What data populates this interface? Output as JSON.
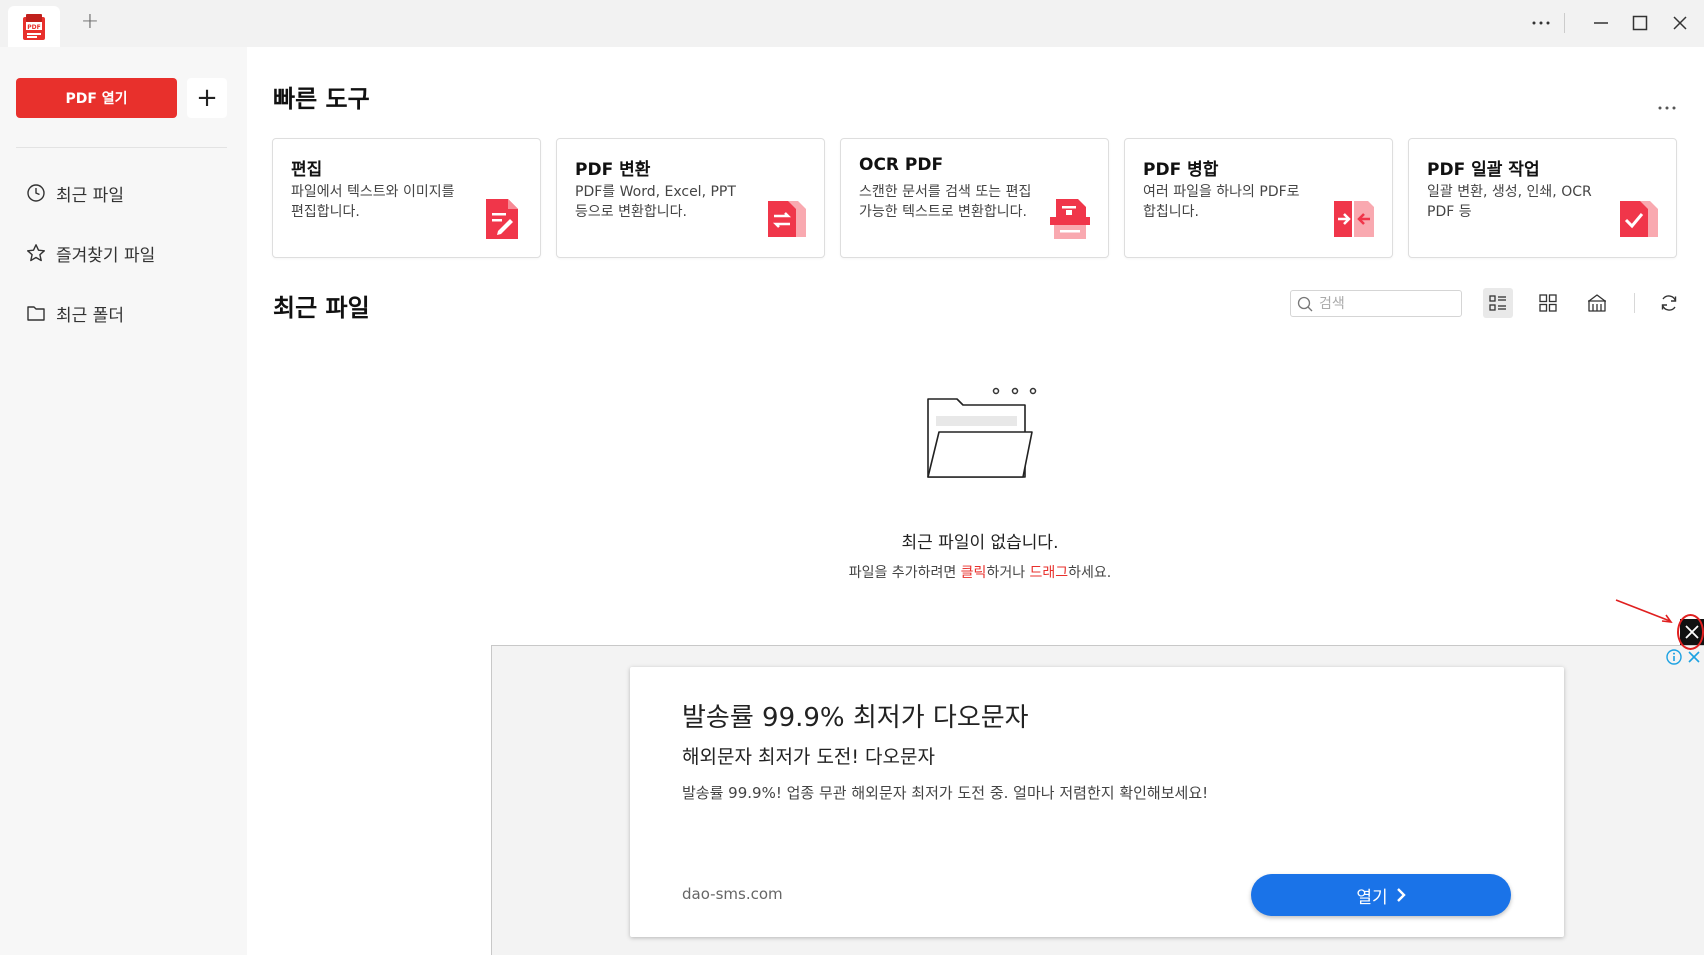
{
  "titlebar": {
    "app_icon": "pdf-app-logo",
    "new_tab_label": "+",
    "more_label": "···"
  },
  "sidebar": {
    "open_pdf_label": "PDF 열기",
    "add_label": "+",
    "items": [
      {
        "label": "최근 파일",
        "icon": "clock-icon"
      },
      {
        "label": "즐겨찾기 파일",
        "icon": "star-icon"
      },
      {
        "label": "최근 폴더",
        "icon": "folder-icon"
      }
    ]
  },
  "quick_tools": {
    "title": "빠른 도구",
    "more_label": "···",
    "cards": [
      {
        "title": "편집",
        "desc": "파일에서 텍스트와 이미지를 편집합니다.",
        "icon": "edit-pdf-icon"
      },
      {
        "title": "PDF 변환",
        "desc": "PDF를 Word, Excel, PPT 등으로 변환합니다.",
        "icon": "convert-pdf-icon"
      },
      {
        "title": "OCR PDF",
        "desc": "스캔한 문서를 검색 또는 편집 가능한 텍스트로 변환합니다.",
        "icon": "ocr-pdf-icon"
      },
      {
        "title": "PDF 병합",
        "desc": "여러 파일을 하나의 PDF로 합칩니다.",
        "icon": "merge-pdf-icon"
      },
      {
        "title": "PDF 일괄 작업",
        "desc": "일괄 변환, 생성, 인쇄, OCR PDF 등",
        "icon": "batch-pdf-icon"
      }
    ]
  },
  "recent": {
    "title": "최근 파일",
    "search_placeholder": "검색",
    "empty_title": "최근 파일이 없습니다.",
    "empty_sub_1": "파일을 추가하려면 ",
    "empty_sub_click": "클릭",
    "empty_sub_2": "하거나 ",
    "empty_sub_drag": "드래그",
    "empty_sub_3": "하세요."
  },
  "ad": {
    "headline": "발송률 99.9% 최저가 다오문자",
    "subheadline": "해외문자 최저가 도전! 다오문자",
    "body": "발송률 99.9%! 업종 무관 해외문자 최저가 도전 중. 얼마나 저렴한지 확인해보세요!",
    "domain": "dao-sms.com",
    "cta_label": "열기",
    "cta_color": "#1a73e8"
  },
  "colors": {
    "brand_red": "#e8302c",
    "icon_red": "#f0364a"
  }
}
